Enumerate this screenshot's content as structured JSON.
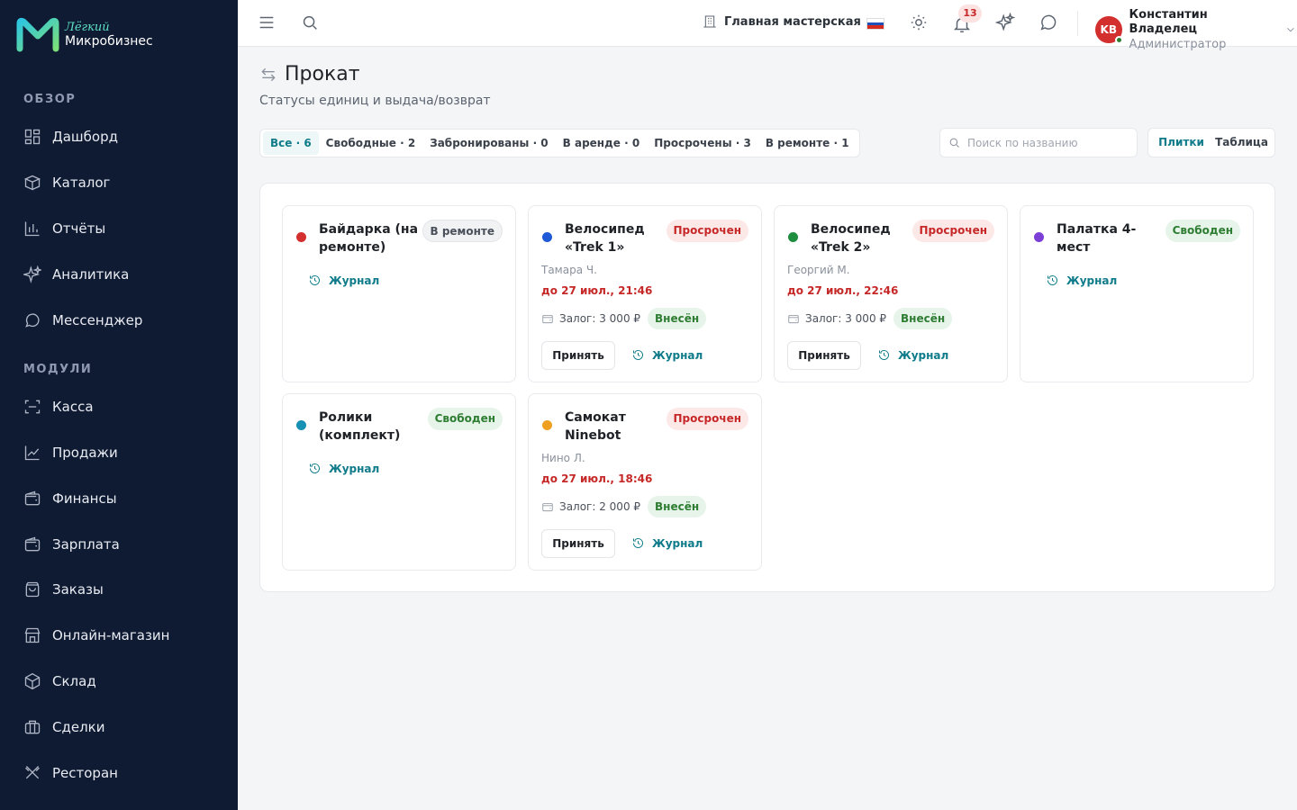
{
  "brand": {
    "top": "Лёгкий",
    "bottom": "Микробизнес"
  },
  "sidebar": {
    "overview_title": "ОБЗОР",
    "overview_items": [
      {
        "label": "Дашборд",
        "icon": "dashboard-icon"
      },
      {
        "label": "Каталог",
        "icon": "catalog-icon"
      },
      {
        "label": "Отчёты",
        "icon": "reports-icon"
      },
      {
        "label": "Аналитика",
        "icon": "sparkles-icon"
      },
      {
        "label": "Мессенджер",
        "icon": "chat-icon"
      }
    ],
    "modules_title": "МОДУЛИ",
    "module_items": [
      {
        "label": "Касса",
        "icon": "scan-icon"
      },
      {
        "label": "Продажи",
        "icon": "chart-line-icon"
      },
      {
        "label": "Финансы",
        "icon": "wallet-icon"
      },
      {
        "label": "Зарплата",
        "icon": "wallet-icon"
      },
      {
        "label": "Заказы",
        "icon": "bag-icon"
      },
      {
        "label": "Онлайн-магазин",
        "icon": "store-icon"
      },
      {
        "label": "Склад",
        "icon": "box-icon"
      },
      {
        "label": "Сделки",
        "icon": "briefcase-icon"
      },
      {
        "label": "Ресторан",
        "icon": "utensils-icon"
      }
    ]
  },
  "topbar": {
    "workshop": "Главная мастерская",
    "notifications_count": "13",
    "user_initials": "KB",
    "user_name": "Константин Владелец",
    "user_role": "Администратор"
  },
  "page": {
    "title": "Прокат",
    "subtitle": "Статусы единиц и выдача/возврат"
  },
  "filters": [
    {
      "label": "Все · 6",
      "active": true
    },
    {
      "label": "Свободные · 2",
      "active": false
    },
    {
      "label": "Забронированы · 0",
      "active": false
    },
    {
      "label": "В аренде · 0",
      "active": false
    },
    {
      "label": "Просрочены · 3",
      "active": false
    },
    {
      "label": "В ремонте · 1",
      "active": false
    }
  ],
  "search": {
    "placeholder": "Поиск по названию"
  },
  "view": {
    "tiles": "Плитки",
    "table": "Таблица",
    "active": "tiles"
  },
  "cards": [
    {
      "name": "Байдарка (на ремонте)",
      "dot_color": "#d32f2f",
      "status": "В ремонте",
      "status_kind": "repair",
      "journal": "Журнал"
    },
    {
      "name": "Велосипед «Trek 1»",
      "dot_color": "#1e5ad6",
      "status": "Просрочен",
      "status_kind": "overdue",
      "renter": "Тамара Ч.",
      "due": "до 27 июл., 21:46",
      "deposit": "Залог: 3 000 ₽",
      "paid": "Внесён",
      "accept": "Принять",
      "journal": "Журнал"
    },
    {
      "name": "Велосипед «Trek 2»",
      "dot_color": "#1e8e3e",
      "status": "Просрочен",
      "status_kind": "overdue",
      "renter": "Георгий М.",
      "due": "до 27 июл., 22:46",
      "deposit": "Залог: 3 000 ₽",
      "paid": "Внесён",
      "accept": "Принять",
      "journal": "Журнал"
    },
    {
      "name": "Палатка 4-мест",
      "dot_color": "#7b3fd6",
      "status": "Свободен",
      "status_kind": "free",
      "journal": "Журнал"
    },
    {
      "name": "Ролики (комплект)",
      "dot_color": "#1690b3",
      "status": "Свободен",
      "status_kind": "free",
      "journal": "Журнал"
    },
    {
      "name": "Самокат Ninebot",
      "dot_color": "#f0a020",
      "status": "Просрочен",
      "status_kind": "overdue",
      "renter": "Нино Л.",
      "due": "до 27 июл., 18:46",
      "deposit": "Залог: 2 000 ₽",
      "paid": "Внесён",
      "accept": "Принять",
      "journal": "Журнал"
    }
  ]
}
